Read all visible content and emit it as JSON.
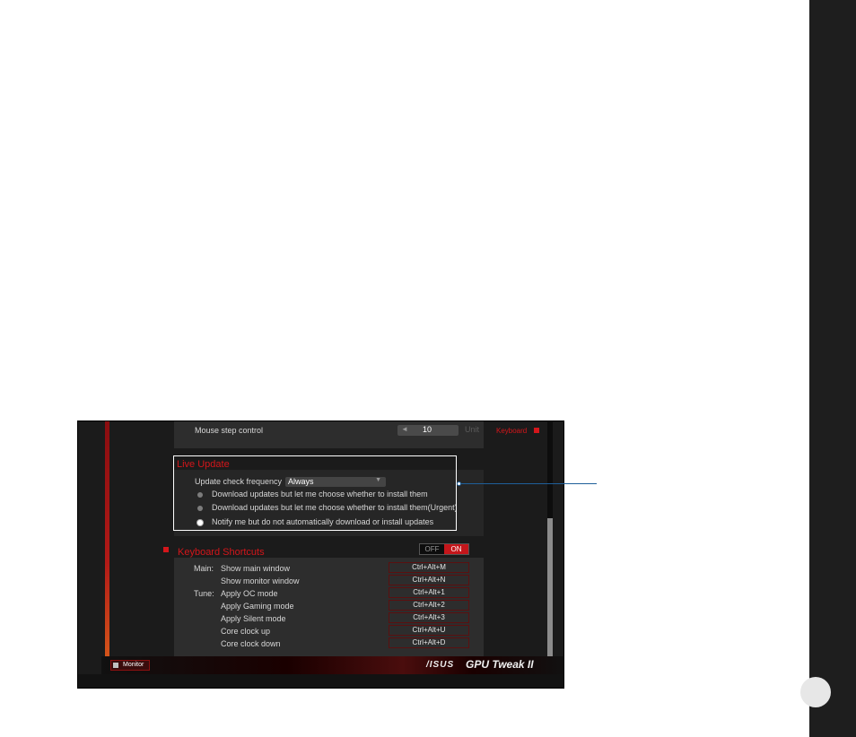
{
  "settings": {
    "mouse_step": {
      "label": "Mouse step control",
      "arrow": "◄",
      "value": "10",
      "unit": "Unit"
    },
    "side_nav": {
      "keyboard_label": "Keyboard"
    },
    "live_update": {
      "title": "Live Update",
      "frequency_label": "Update check frequency",
      "frequency_value": "Always",
      "options": [
        "Download updates but let me choose whether to install them",
        "Download updates but let me choose whether to install them(Urgent)",
        "Notify me but do not automatically download or install updates"
      ],
      "selected_index": 2
    },
    "keyboard_shortcuts": {
      "title": "Keyboard Shortcuts",
      "toggle_off": "OFF",
      "toggle_on": "ON",
      "group_main": "Main:",
      "group_tune": "Tune:",
      "rows": [
        {
          "action": "Show main window",
          "keys": "Ctrl+Alt+M"
        },
        {
          "action": "Show monitor window",
          "keys": "Ctrl+Alt+N"
        },
        {
          "action": "Apply OC mode",
          "keys": "Ctrl+Alt+1"
        },
        {
          "action": "Apply Gaming mode",
          "keys": "Ctrl+Alt+2"
        },
        {
          "action": "Apply Silent mode",
          "keys": "Ctrl+Alt+3"
        },
        {
          "action": "Core clock up",
          "keys": "Ctrl+Alt+U"
        },
        {
          "action": "Core clock down",
          "keys": "Ctrl+Alt+D"
        }
      ]
    },
    "footer": {
      "monitor_label": "Monitor",
      "brand": "/ISUS",
      "product": "GPU Tweak II"
    }
  },
  "colors": {
    "accent_red": "#d4161b",
    "panel": "#2d2d2d",
    "callout_blue": "#1f5f99"
  }
}
